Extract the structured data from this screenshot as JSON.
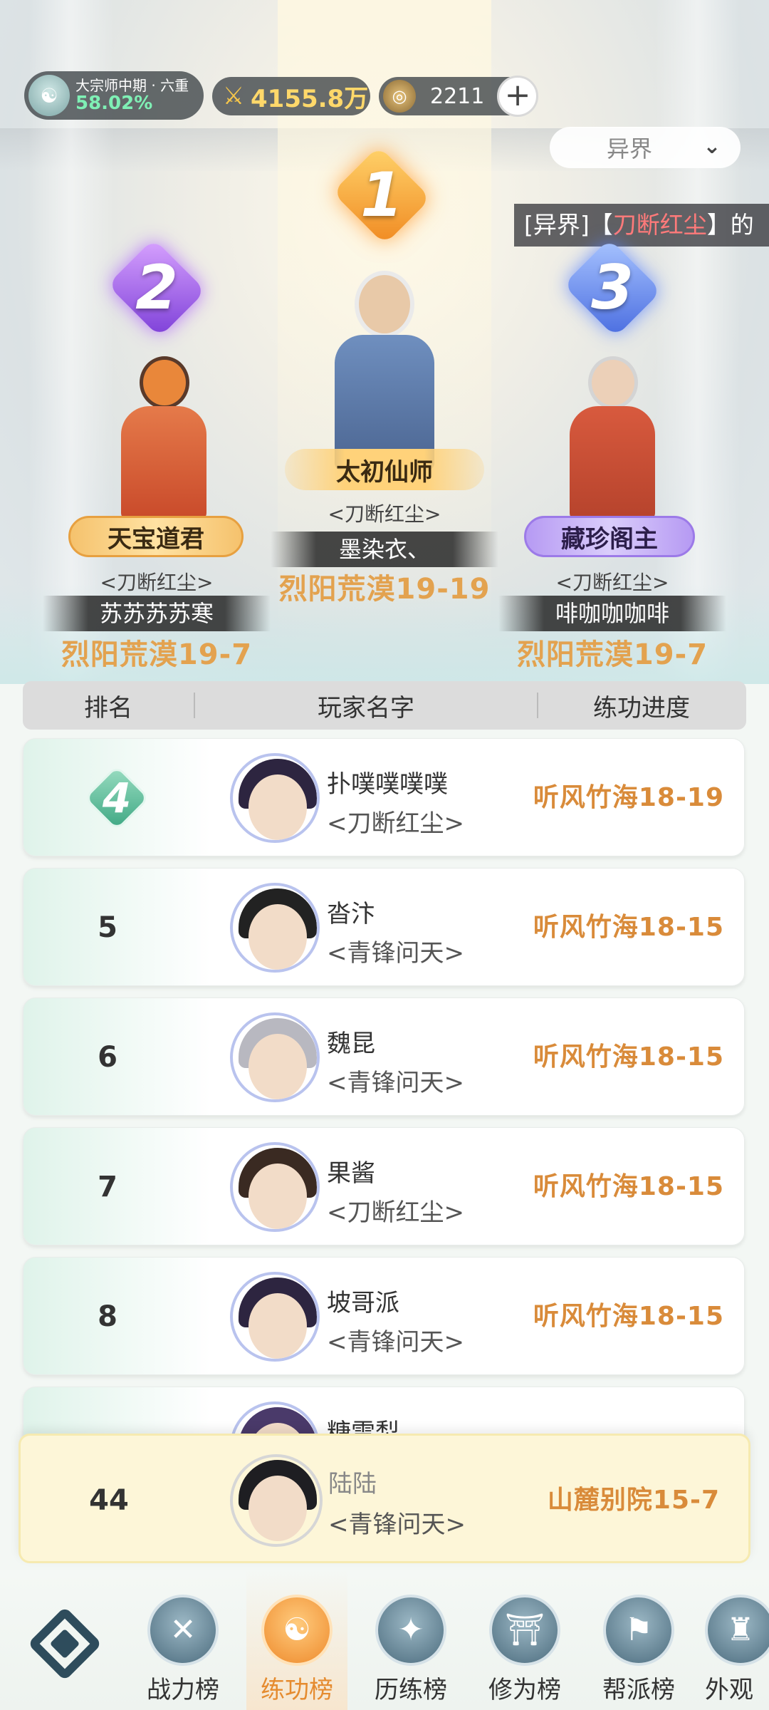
{
  "header": {
    "realm_rank": "大宗师中期 · 六重",
    "realm_percent": "58.02%",
    "power": "4155.8万",
    "currency": "2211",
    "add_symbol": "+",
    "filter_selected": "异界",
    "marquee_prefix": "[异界]【",
    "marquee_highlight": "刀断红尘",
    "marquee_suffix": "】的"
  },
  "podium": {
    "first": {
      "rank": "1",
      "title": "太初仙师",
      "guild": "<刀断红尘>",
      "player": "墨染衣、",
      "progress": "烈阳荒漠19-19"
    },
    "second": {
      "rank": "2",
      "title": "天宝道君",
      "guild": "<刀断红尘>",
      "player": "苏苏苏苏寒",
      "progress": "烈阳荒漠19-7"
    },
    "third": {
      "rank": "3",
      "title": "藏珍阁主",
      "guild": "<刀断红尘>",
      "player": "啡咖咖咖啡",
      "progress": "烈阳荒漠19-7"
    }
  },
  "table": {
    "headers": {
      "rank": "排名",
      "name": "玩家名字",
      "progress": "练功进度"
    },
    "rows": [
      {
        "rank": "4",
        "name": "扑噗噗噗噗",
        "guild": "<刀断红尘>",
        "progress": "听风竹海18-19"
      },
      {
        "rank": "5",
        "name": "沓汴",
        "guild": "<青锋问天>",
        "progress": "听风竹海18-15"
      },
      {
        "rank": "6",
        "name": "魏昆",
        "guild": "<青锋问天>",
        "progress": "听风竹海18-15"
      },
      {
        "rank": "7",
        "name": "果酱",
        "guild": "<刀断红尘>",
        "progress": "听风竹海18-15"
      },
      {
        "rank": "8",
        "name": "坡哥派",
        "guild": "<青锋问天>",
        "progress": "听风竹海18-15"
      },
      {
        "rank": "",
        "name": "糖雪梨",
        "guild": "",
        "progress": ""
      }
    ]
  },
  "me": {
    "rank": "44",
    "name": "陆陆",
    "guild": "<青锋问天>",
    "progress": "山麓别院15-7"
  },
  "nav": {
    "items": [
      {
        "label": "战力榜",
        "icon": "swords-icon"
      },
      {
        "label": "练功榜",
        "icon": "yin-yang-icon"
      },
      {
        "label": "历练榜",
        "icon": "star-compass-icon"
      },
      {
        "label": "修为榜",
        "icon": "hat-icon"
      },
      {
        "label": "帮派榜",
        "icon": "banner-icon"
      },
      {
        "label": "外观",
        "icon": "outfit-icon"
      }
    ]
  },
  "colors": {
    "accent": "#e58b2f",
    "progress": "#d98b3a",
    "rank4": "#3fa884"
  }
}
